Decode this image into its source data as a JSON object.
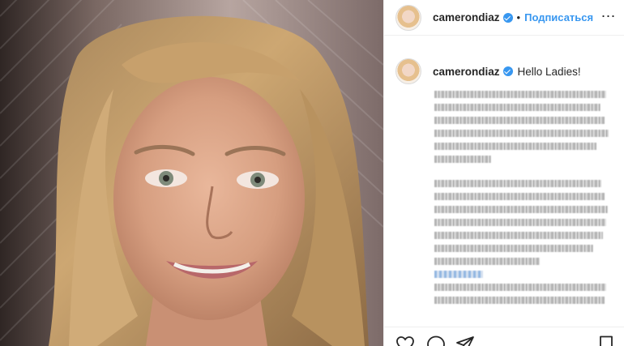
{
  "post": {
    "username": "camerondiaz",
    "separator": "•",
    "follow_label": "Подписаться",
    "more_icon": "more-options-icon",
    "caption": "Hello Ladies!",
    "caption_paragraph_1_lines": 6,
    "caption_paragraph_2_lines": 10
  },
  "actions": {
    "icons": [
      "heart-icon",
      "comment-icon",
      "share-icon",
      "bookmark-icon"
    ]
  },
  "colors": {
    "link_blue": "#3897f0",
    "text": "#262626",
    "divider": "#efefef"
  }
}
